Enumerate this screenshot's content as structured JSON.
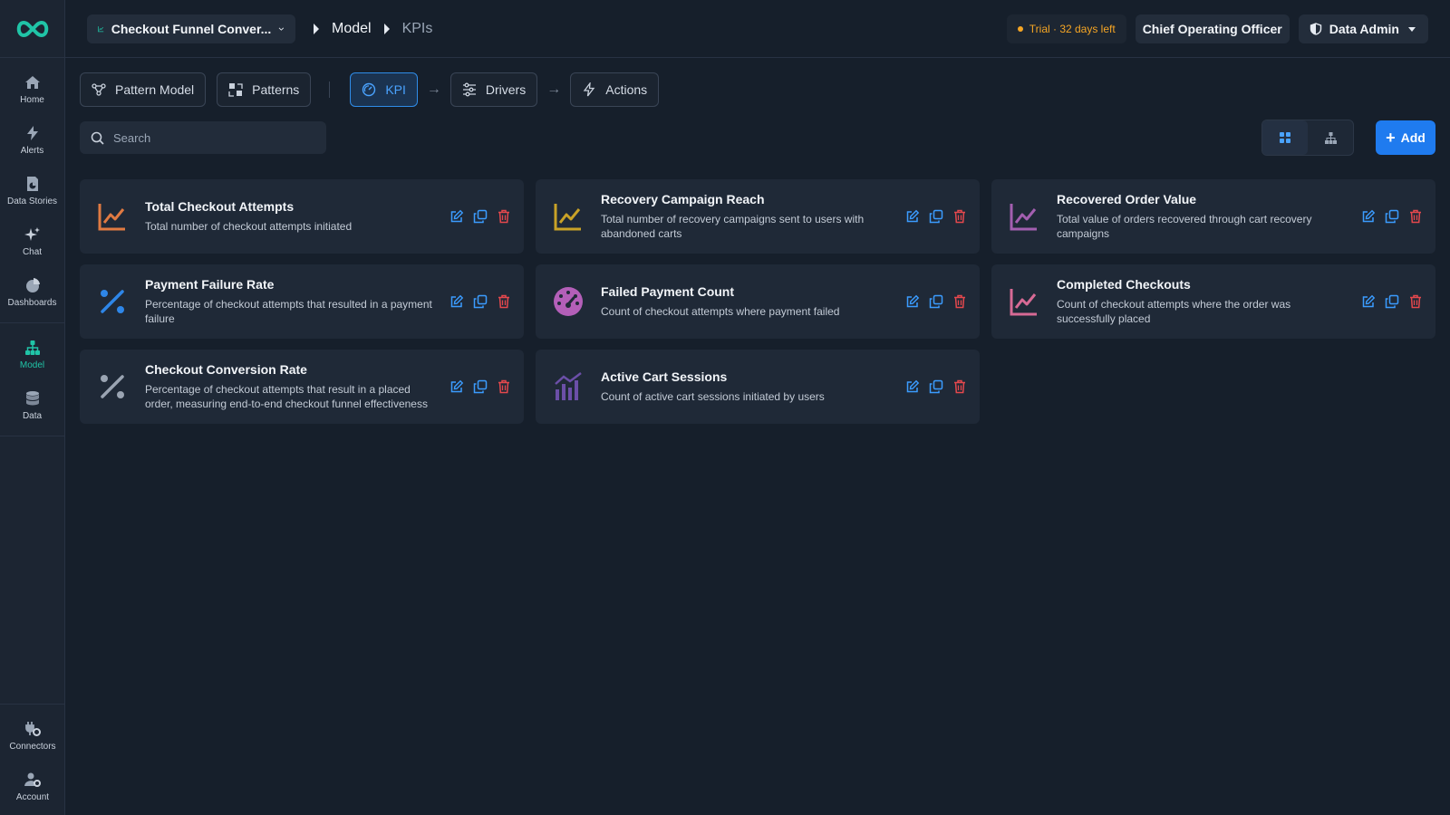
{
  "sidebar": {
    "items": [
      {
        "label": "Home"
      },
      {
        "label": "Alerts"
      },
      {
        "label": "Data Stories"
      },
      {
        "label": "Chat"
      },
      {
        "label": "Dashboards"
      }
    ],
    "model_items": [
      {
        "label": "Model"
      },
      {
        "label": "Data"
      }
    ],
    "bottom_items": [
      {
        "label": "Connectors"
      },
      {
        "label": "Account"
      }
    ],
    "accent": "#20c4a7"
  },
  "header": {
    "model_name": "Checkout Funnel Conver...",
    "breadcrumb": [
      "Model",
      "KPIs"
    ],
    "trial": "Trial · 32 days left",
    "role": "Chief Operating Officer",
    "admin": "Data Admin"
  },
  "tabs": [
    {
      "label": "Pattern Model",
      "icon": "share-nodes-icon"
    },
    {
      "label": "Patterns",
      "icon": "patterns-icon"
    },
    {
      "label": "KPI",
      "icon": "gauge-icon"
    },
    {
      "label": "Drivers",
      "icon": "sliders-icon"
    },
    {
      "label": "Actions",
      "icon": "bolt-icon"
    }
  ],
  "search": {
    "placeholder": "Search"
  },
  "add_button": {
    "label": "Add"
  },
  "kpis": [
    {
      "title": "Total Checkout Attempts",
      "description": "Total number of checkout attempts initiated",
      "icon": "line-chart-icon",
      "color": "#e07a42"
    },
    {
      "title": "Recovery Campaign Reach",
      "description": "Total number of recovery campaigns sent to users with abandoned carts",
      "icon": "line-chart-icon",
      "color": "#c9a227"
    },
    {
      "title": "Recovered Order Value",
      "description": "Total value of orders recovered through cart recovery campaigns",
      "icon": "line-chart-icon",
      "color": "#a35fb0"
    },
    {
      "title": "Payment Failure Rate",
      "description": "Percentage of checkout attempts that resulted in a payment failure",
      "icon": "percent-icon",
      "color": "#2e86e8"
    },
    {
      "title": "Failed Payment Count",
      "description": "Count of checkout attempts where payment failed",
      "icon": "gauge-icon",
      "color": "#b35fb8"
    },
    {
      "title": "Completed Checkouts",
      "description": "Count of checkout attempts where the order was successfully placed",
      "icon": "line-chart-icon",
      "color": "#d76a95"
    },
    {
      "title": "Checkout Conversion Rate",
      "description": "Percentage of checkout attempts that result in a placed order, measuring end-to-end checkout funnel effectiveness",
      "icon": "percent-icon",
      "color": "#9aa4b2"
    },
    {
      "title": "Active Cart Sessions",
      "description": "Count of active cart sessions initiated by users",
      "icon": "bar-line-chart-icon",
      "color": "#6b4fa8"
    }
  ],
  "colors": {
    "edit": "#3b9cff",
    "copy": "#3b9cff",
    "delete": "#e5484d",
    "primary": "#1f7bef"
  }
}
